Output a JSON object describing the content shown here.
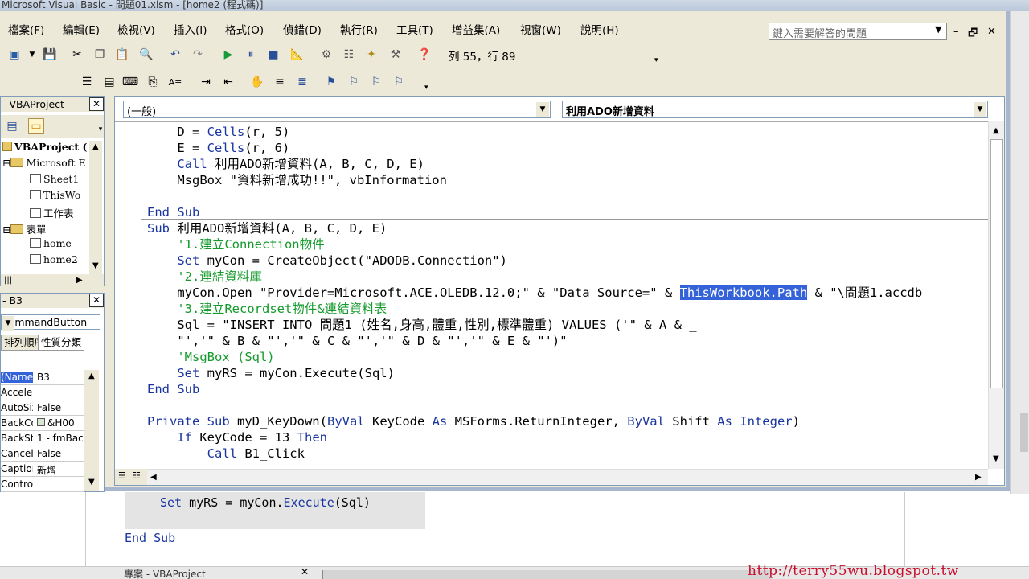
{
  "app": {
    "title_fragment": "Microsoft Visual Basic - 問題01.xlsm - [home2 (程式碼)]"
  },
  "menubar": {
    "items": [
      "檔案(F)",
      "編輯(E)",
      "檢視(V)",
      "插入(I)",
      "格式(O)",
      "偵錯(D)",
      "執行(R)",
      "工具(T)",
      "增益集(A)",
      "視窗(W)",
      "說明(H)"
    ],
    "help_placeholder": "鍵入需要解答的問題"
  },
  "toolbar": {
    "row_col": "列 55，行 89"
  },
  "project_pane": {
    "title": "- VBAProject",
    "tree": [
      "VBAProject (",
      "Microsoft E",
      "Sheet1",
      "ThisWo",
      "工作表",
      "表單",
      "home",
      "home2"
    ]
  },
  "properties_pane": {
    "title": "- B3",
    "object": "CommandButton",
    "tabs": [
      "排列順序",
      "性質分類"
    ],
    "rows": [
      {
        "name": "(Name)",
        "value": "B3"
      },
      {
        "name": "Accelerator",
        "value": ""
      },
      {
        "name": "AutoSize",
        "value": "False"
      },
      {
        "name": "BackColor",
        "value": "&H00"
      },
      {
        "name": "BackStyle",
        "value": "1 - fmBac"
      },
      {
        "name": "Cancel",
        "value": "False"
      },
      {
        "name": "Caption",
        "value": "新增"
      },
      {
        "name": "ControlTip",
        "value": ""
      }
    ]
  },
  "code_window": {
    "object_combo": "(一般)",
    "proc_combo": "利用ADO新增資料"
  },
  "background": {
    "code_line_1": "Set myRS = myCon.Execute(Sql)",
    "code_line_2": "End Sub",
    "task_label": "專案 - VBAProject",
    "watermark": "http://terry55wu.blogspot.tw"
  }
}
